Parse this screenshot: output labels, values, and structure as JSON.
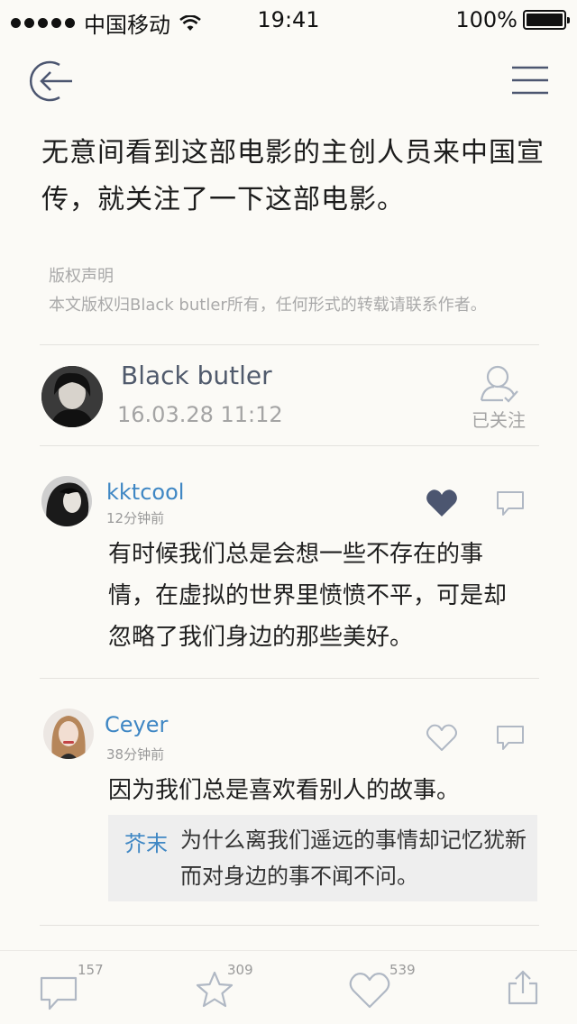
{
  "status_bar": {
    "carrier": "中国移动",
    "time": "19:41",
    "battery": "100%"
  },
  "article": {
    "text": "无意间看到这部电影的主创人员来中国宣传，就关注了一下这部电影。",
    "copyright_title": "版权声明",
    "copyright_body": "本文版权归Black butler所有，任何形式的转载请联系作者。"
  },
  "author": {
    "name": "Black butler",
    "date": "16.03.28 11:12",
    "follow_label": "已关注"
  },
  "comments": [
    {
      "user": "kktcool",
      "time": "12分钟前",
      "text": "有时候我们总是会想一些不存在的事情，在虚拟的世界里愤愤不平，可是却忽略了我们身边的那些美好。",
      "liked": true
    },
    {
      "user": "Ceyer",
      "time": "38分钟前",
      "text": "因为我们总是喜欢看别人的故事。",
      "liked": false,
      "reply": {
        "user": "芥末",
        "text": "为什么离我们遥远的事情却记忆犹新而对身边的事不闻不问。"
      }
    }
  ],
  "bottom_bar": {
    "comments_count": "157",
    "favorites_count": "309",
    "likes_count": "539"
  },
  "colors": {
    "background": "#fbfaf6",
    "link_blue": "#3f87c4",
    "icon_gray": "#b0b8c4",
    "icon_dark": "#4c5670"
  }
}
